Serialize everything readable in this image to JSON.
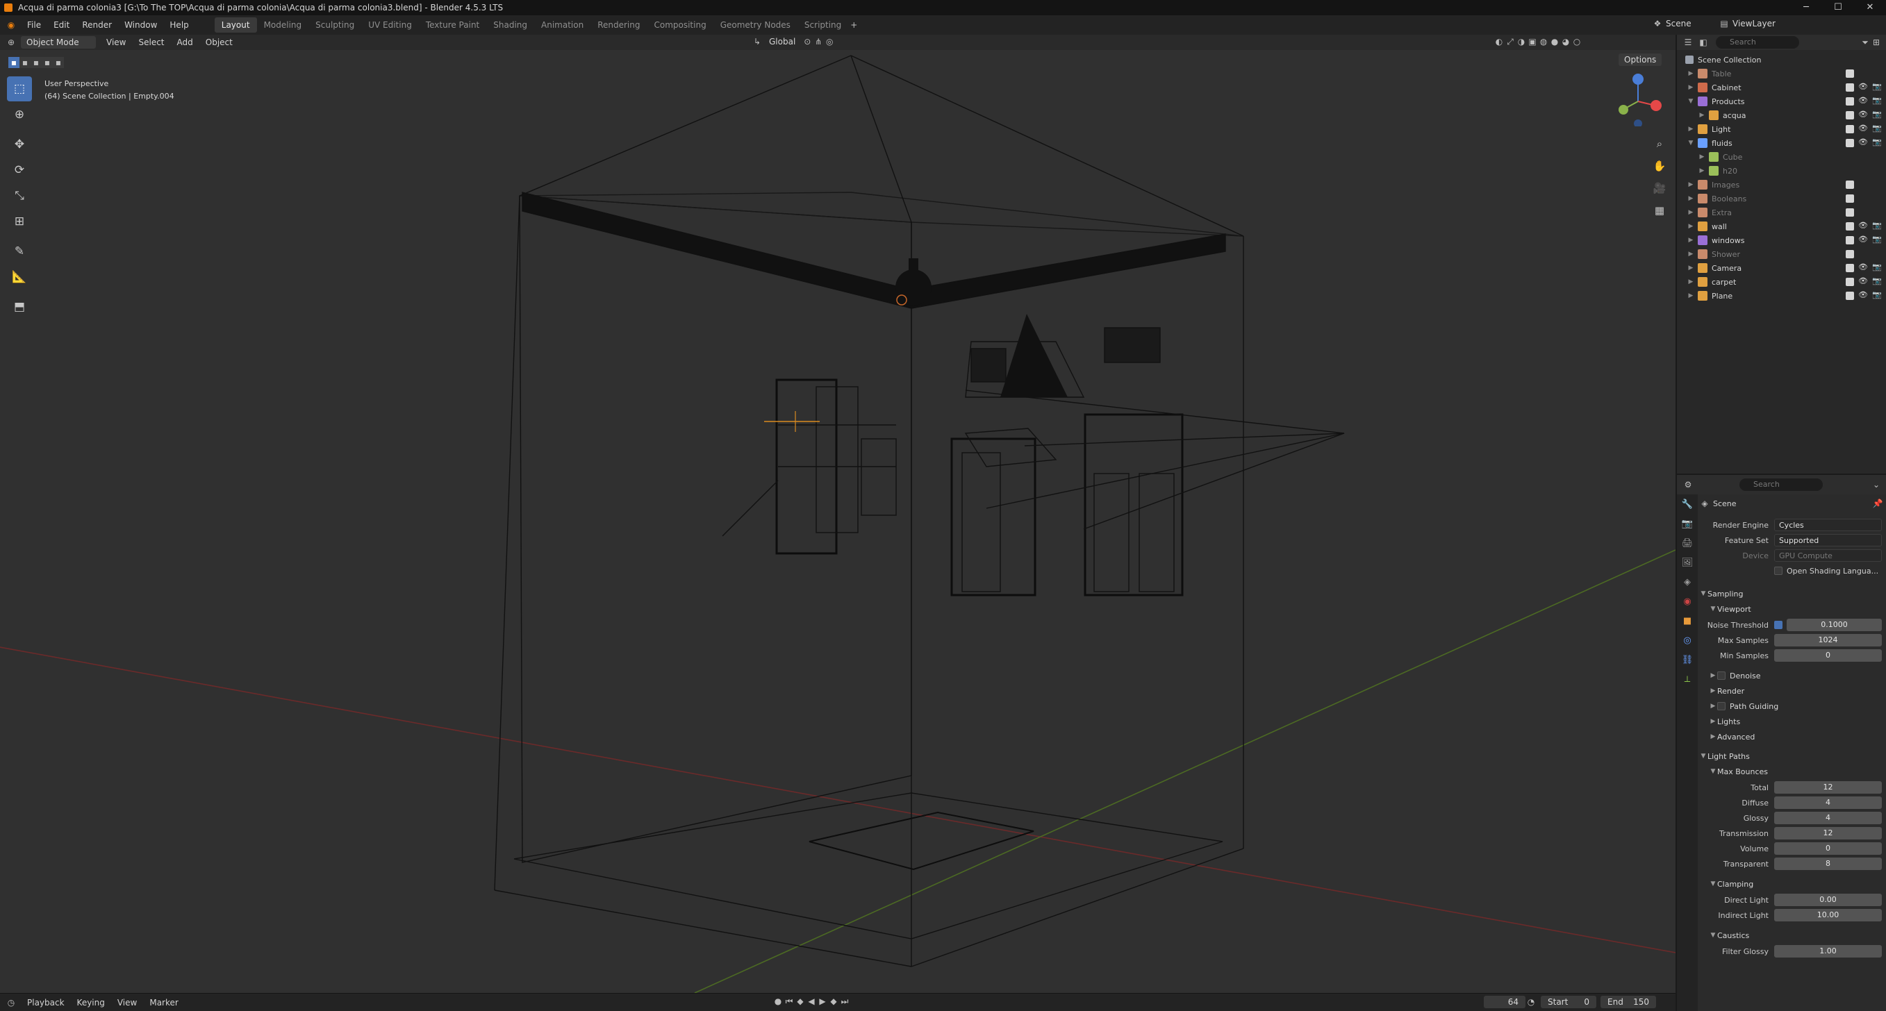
{
  "titlebar": {
    "title": "Acqua di parma colonia3 [G:\\To The TOP\\Acqua di parma colonia\\Acqua di parma colonia3.blend] - Blender 4.5.3 LTS",
    "minimize": "─",
    "maximize": "☐",
    "close": "✕"
  },
  "menu": [
    "File",
    "Edit",
    "Render",
    "Window",
    "Help"
  ],
  "workspaces": [
    "Layout",
    "Modeling",
    "Sculpting",
    "UV Editing",
    "Texture Paint",
    "Shading",
    "Animation",
    "Rendering",
    "Compositing",
    "Geometry Nodes",
    "Scripting"
  ],
  "active_workspace": "Layout",
  "scene_name": "Scene",
  "view_layer": "ViewLayer",
  "viewport_header": {
    "mode": "Object Mode",
    "menus": [
      "View",
      "Select",
      "Add",
      "Object"
    ],
    "transform": "Global",
    "options": "Options"
  },
  "viewport": {
    "perspective": "User Perspective",
    "collection_info": "(64) Scene Collection | Empty.004"
  },
  "timeline": {
    "menus": [
      "Playback",
      "Keying",
      "View",
      "Marker"
    ],
    "current_frame": "64",
    "start_label": "Start",
    "start": "0",
    "end_label": "End",
    "end": "150"
  },
  "outliner": {
    "search_placeholder": "Search",
    "root": "Scene Collection",
    "items": [
      {
        "label": "Table",
        "dim": true,
        "indent": 0
      },
      {
        "label": "Cabinet",
        "dim": false,
        "indent": 0
      },
      {
        "label": "Products",
        "dim": false,
        "indent": 0
      },
      {
        "label": "acqua",
        "dim": false,
        "indent": 1
      },
      {
        "label": "Light",
        "dim": false,
        "indent": 0
      },
      {
        "label": "fluids",
        "dim": false,
        "indent": 0
      },
      {
        "label": "Cube",
        "dim": true,
        "indent": 1
      },
      {
        "label": "h20",
        "dim": true,
        "indent": 1
      },
      {
        "label": "Images",
        "dim": true,
        "indent": 0
      },
      {
        "label": "Booleans",
        "dim": true,
        "indent": 0
      },
      {
        "label": "Extra",
        "dim": true,
        "indent": 0
      },
      {
        "label": "wall",
        "dim": false,
        "indent": 0
      },
      {
        "label": "windows",
        "dim": false,
        "indent": 0
      },
      {
        "label": "Shower",
        "dim": true,
        "indent": 0
      },
      {
        "label": "Camera",
        "dim": false,
        "indent": 0
      },
      {
        "label": "carpet",
        "dim": false,
        "indent": 0
      },
      {
        "label": "Plane",
        "dim": false,
        "indent": 0
      }
    ]
  },
  "properties": {
    "search_placeholder": "Search",
    "context": "Scene",
    "render_engine_label": "Render Engine",
    "render_engine": "Cycles",
    "feature_set_label": "Feature Set",
    "feature_set": "Supported",
    "device_label": "Device",
    "device": "GPU Compute",
    "osl": "Open Shading Langua...",
    "sampling": "Sampling",
    "viewport_sub": "Viewport",
    "noise_threshold_label": "Noise Threshold",
    "noise_threshold": "0.1000",
    "max_samples_label": "Max Samples",
    "max_samples": "1024",
    "min_samples_label": "Min Samples",
    "min_samples": "0",
    "denoise": "Denoise",
    "render": "Render",
    "path_guiding": "Path Guiding",
    "lights": "Lights",
    "advanced": "Advanced",
    "light_paths": "Light Paths",
    "max_bounces": "Max Bounces",
    "bounces": [
      {
        "label": "Total",
        "value": "12"
      },
      {
        "label": "Diffuse",
        "value": "4"
      },
      {
        "label": "Glossy",
        "value": "4"
      },
      {
        "label": "Transmission",
        "value": "12"
      },
      {
        "label": "Volume",
        "value": "0"
      },
      {
        "label": "Transparent",
        "value": "8"
      }
    ],
    "clamping": "Clamping",
    "direct_light_label": "Direct Light",
    "direct_light": "0.00",
    "indirect_light_label": "Indirect Light",
    "indirect_light": "10.00",
    "caustics": "Caustics",
    "filter_glossy_label": "Filter Glossy",
    "filter_glossy": "1.00"
  }
}
